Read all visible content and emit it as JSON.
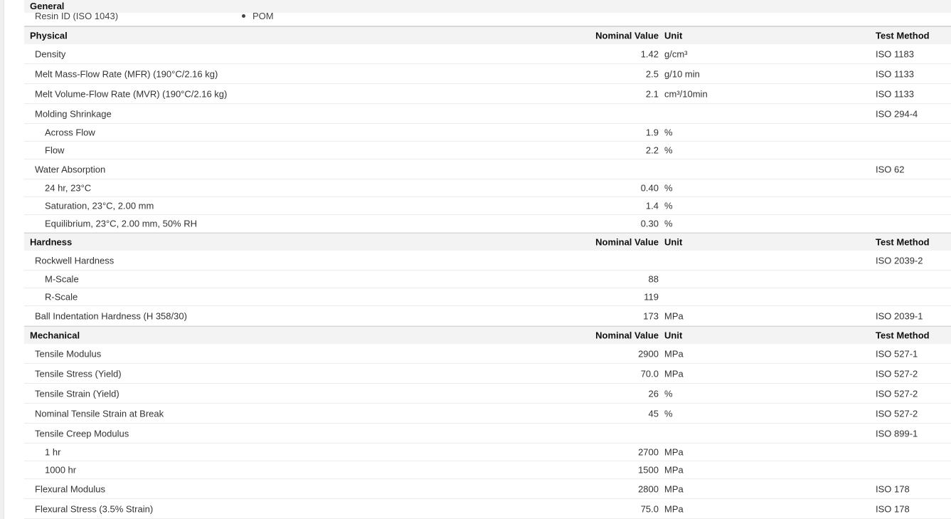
{
  "general": {
    "title": "General",
    "resin_label": "Resin ID (ISO 1043)",
    "resin_value": "POM"
  },
  "headers": {
    "nominal_value": "Nominal Value",
    "unit": "Unit",
    "test_method": "Test Method"
  },
  "sections": [
    {
      "title": "Physical",
      "rows": [
        {
          "name": "Density",
          "value": "1.42",
          "unit": "g/cm³",
          "test": "ISO 1183",
          "sub": false
        },
        {
          "name": "Melt Mass-Flow Rate (MFR) (190°C/2.16 kg)",
          "value": "2.5",
          "unit": "g/10 min",
          "test": "ISO 1133",
          "sub": false
        },
        {
          "name": "Melt Volume-Flow Rate (MVR) (190°C/2.16 kg)",
          "value": "2.1",
          "unit": "cm³/10min",
          "test": "ISO 1133",
          "sub": false
        },
        {
          "name": "Molding Shrinkage",
          "value": "",
          "unit": "",
          "test": "ISO 294-4",
          "sub": false
        },
        {
          "name": "Across Flow",
          "value": "1.9",
          "unit": "%",
          "test": "",
          "sub": true
        },
        {
          "name": "Flow",
          "value": "2.2",
          "unit": "%",
          "test": "",
          "sub": true
        },
        {
          "name": "Water Absorption",
          "value": "",
          "unit": "",
          "test": "ISO 62",
          "sub": false
        },
        {
          "name": "24 hr, 23°C",
          "value": "0.40",
          "unit": "%",
          "test": "",
          "sub": true
        },
        {
          "name": "Saturation, 23°C, 2.00 mm",
          "value": "1.4",
          "unit": "%",
          "test": "",
          "sub": true
        },
        {
          "name": "Equilibrium, 23°C, 2.00 mm, 50% RH",
          "value": "0.30",
          "unit": "%",
          "test": "",
          "sub": true
        }
      ]
    },
    {
      "title": "Hardness",
      "rows": [
        {
          "name": "Rockwell Hardness",
          "value": "",
          "unit": "",
          "test": "ISO 2039-2",
          "sub": false
        },
        {
          "name": "M-Scale",
          "value": "88",
          "unit": "",
          "test": "",
          "sub": true
        },
        {
          "name": "R-Scale",
          "value": "119",
          "unit": "",
          "test": "",
          "sub": true
        },
        {
          "name": "Ball Indentation Hardness (H 358/30)",
          "value": "173",
          "unit": "MPa",
          "test": "ISO 2039-1",
          "sub": false
        }
      ]
    },
    {
      "title": "Mechanical",
      "rows": [
        {
          "name": "Tensile Modulus",
          "value": "2900",
          "unit": "MPa",
          "test": "ISO 527-1",
          "sub": false
        },
        {
          "name": "Tensile Stress (Yield)",
          "value": "70.0",
          "unit": "MPa",
          "test": "ISO 527-2",
          "sub": false
        },
        {
          "name": "Tensile Strain (Yield)",
          "value": "26",
          "unit": "%",
          "test": "ISO 527-2",
          "sub": false
        },
        {
          "name": "Nominal Tensile Strain at Break",
          "value": "45",
          "unit": "%",
          "test": "ISO 527-2",
          "sub": false
        },
        {
          "name": "Tensile Creep Modulus",
          "value": "",
          "unit": "",
          "test": "ISO 899-1",
          "sub": false
        },
        {
          "name": "1 hr",
          "value": "2700",
          "unit": "MPa",
          "test": "",
          "sub": true
        },
        {
          "name": "1000 hr",
          "value": "1500",
          "unit": "MPa",
          "test": "",
          "sub": true
        },
        {
          "name": "Flexural Modulus",
          "value": "2800",
          "unit": "MPa",
          "test": "ISO 178",
          "sub": false
        },
        {
          "name": "Flexural Stress (3.5% Strain)",
          "value": "75.0",
          "unit": "MPa",
          "test": "ISO 178",
          "sub": false
        }
      ]
    }
  ]
}
